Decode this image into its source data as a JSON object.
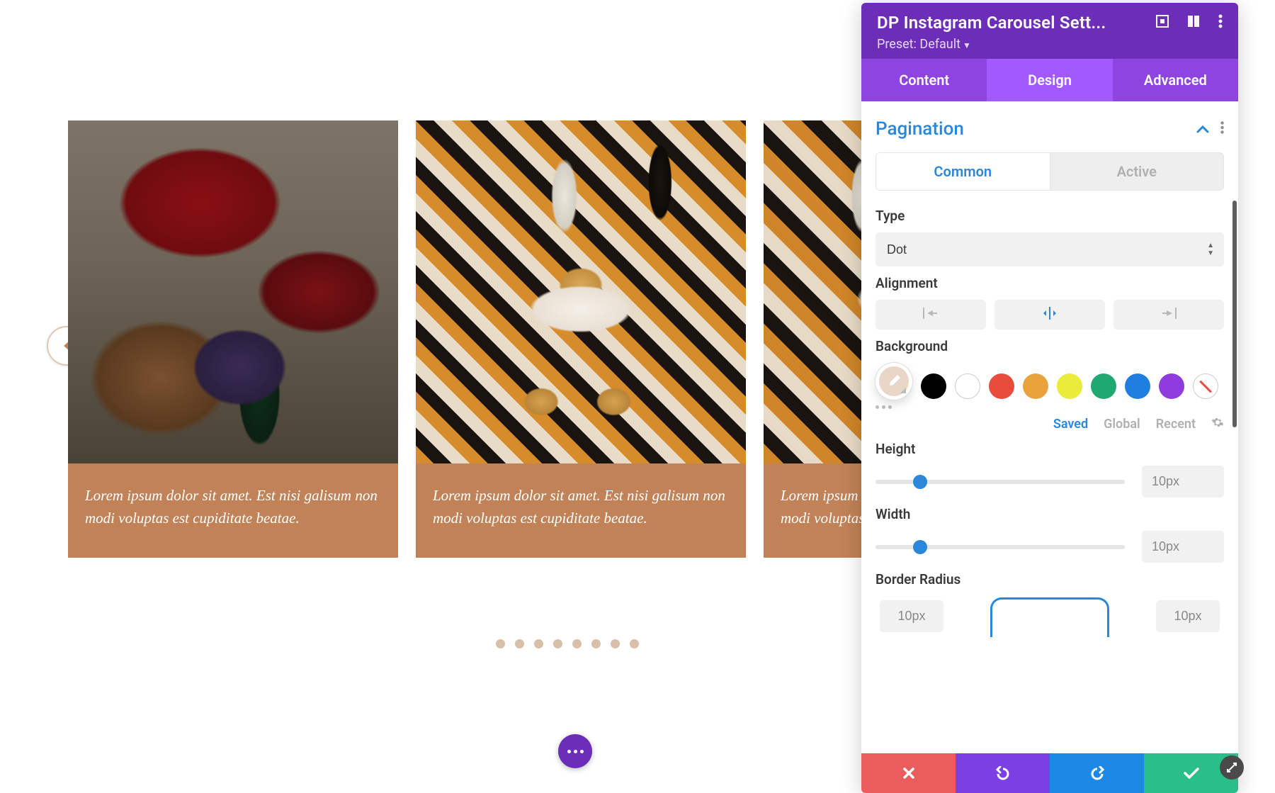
{
  "carousel": {
    "cards": [
      {
        "caption": "Lorem ipsum dolor sit amet. Est nisi galisum non modi voluptas est cupiditate beatae."
      },
      {
        "caption": "Lorem ipsum dolor sit amet. Est nisi galisum non modi voluptas est cupiditate beatae."
      },
      {
        "caption": "Lorem ipsum dolor sit amet. Est nisi galisum non modi voluptas est cupiditate beatae."
      }
    ],
    "dot_count": 8
  },
  "panel": {
    "title": "DP Instagram Carousel Sett...",
    "preset_label": "Preset: Default",
    "tabs": {
      "content": "Content",
      "design": "Design",
      "advanced": "Advanced"
    },
    "section": {
      "title": "Pagination",
      "subtabs": {
        "common": "Common",
        "active": "Active"
      },
      "type": {
        "label": "Type",
        "value": "Dot"
      },
      "alignment": {
        "label": "Alignment"
      },
      "background": {
        "label": "Background",
        "colors": [
          "#000000",
          "#ffffff",
          "#e74c3c",
          "#e8a33d",
          "#ebeb3a",
          "#1fa971",
          "#1e7fe0",
          "#8e3ce0"
        ],
        "saved": "Saved",
        "global": "Global",
        "recent": "Recent"
      },
      "height": {
        "label": "Height",
        "value": "10px"
      },
      "width": {
        "label": "Width",
        "value": "10px"
      },
      "radius": {
        "label": "Border Radius",
        "tl": "10px",
        "tr": "10px"
      }
    }
  }
}
